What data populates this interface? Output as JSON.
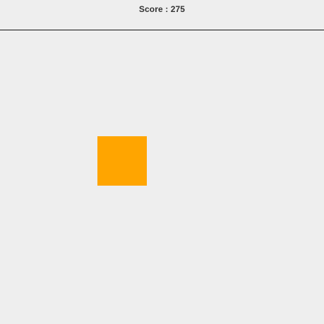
{
  "score": {
    "label": "Score : 275"
  },
  "colors": {
    "background": "#eeeeee",
    "divider": "#111111",
    "score_text": "#333333",
    "target": "#ffa500"
  },
  "target": {
    "shape": "square"
  }
}
